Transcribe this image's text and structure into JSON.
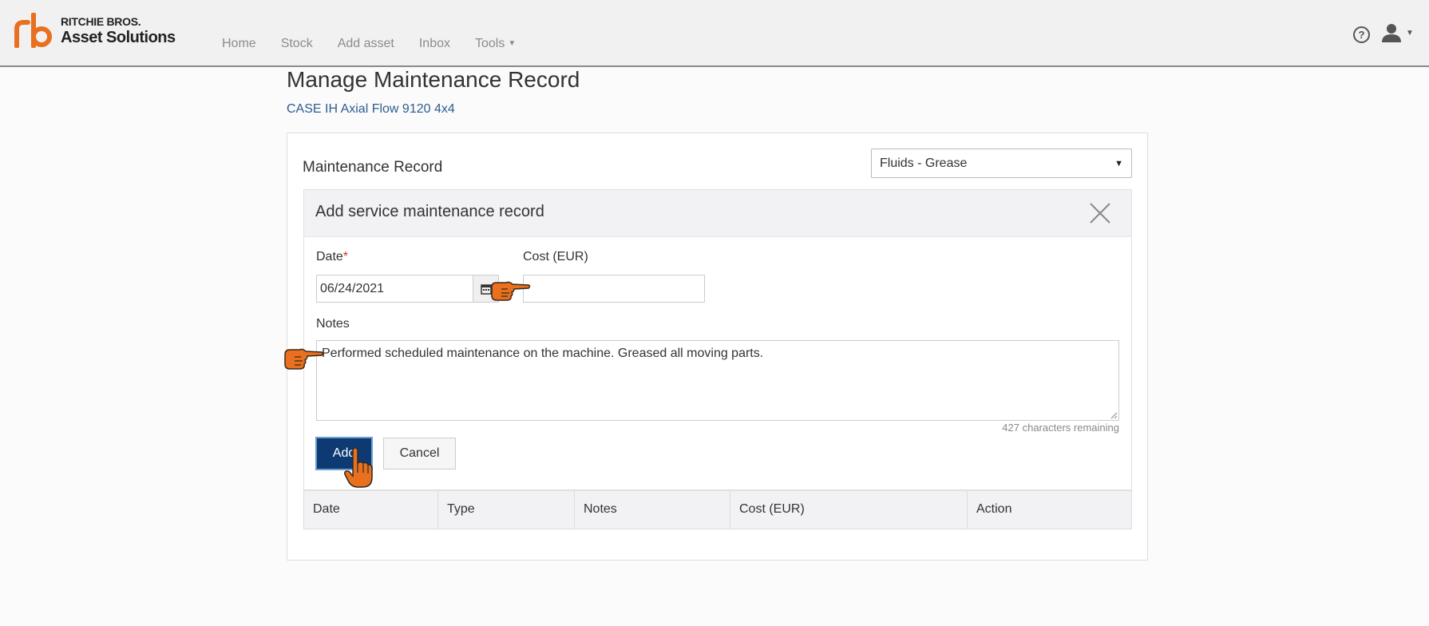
{
  "brand": {
    "line1": "RITCHIE BROS.",
    "line2": "Asset Solutions",
    "color": "#e8701e"
  },
  "nav": {
    "items": [
      "Home",
      "Stock",
      "Add asset",
      "Inbox",
      "Tools"
    ],
    "help_icon": "question-circle-icon",
    "user_icon": "user-icon"
  },
  "page": {
    "title": "Manage Maintenance Record",
    "asset_name": "CASE IH Axial Flow 9120 4x4"
  },
  "card": {
    "label": "Maintenance Record",
    "type_select": {
      "selected": "Fluids - Grease"
    }
  },
  "form": {
    "title": "Add service maintenance record",
    "date_label": "Date",
    "date_required_marker": "*",
    "date_value": "06/24/2021",
    "cost_label": "Cost (EUR)",
    "cost_value": "",
    "notes_label": "Notes",
    "notes_value": "Performed scheduled maintenance on the machine. Greased all moving parts.",
    "chars_remaining": "427 characters remaining",
    "add_label": "Add",
    "cancel_label": "Cancel"
  },
  "table": {
    "columns": [
      "Date",
      "Type",
      "Notes",
      "Cost (EUR)",
      "Action"
    ],
    "rows": []
  },
  "colors": {
    "primary_button": "#0d3a73",
    "link": "#2c5d8f",
    "pointer": "#e8701e"
  }
}
